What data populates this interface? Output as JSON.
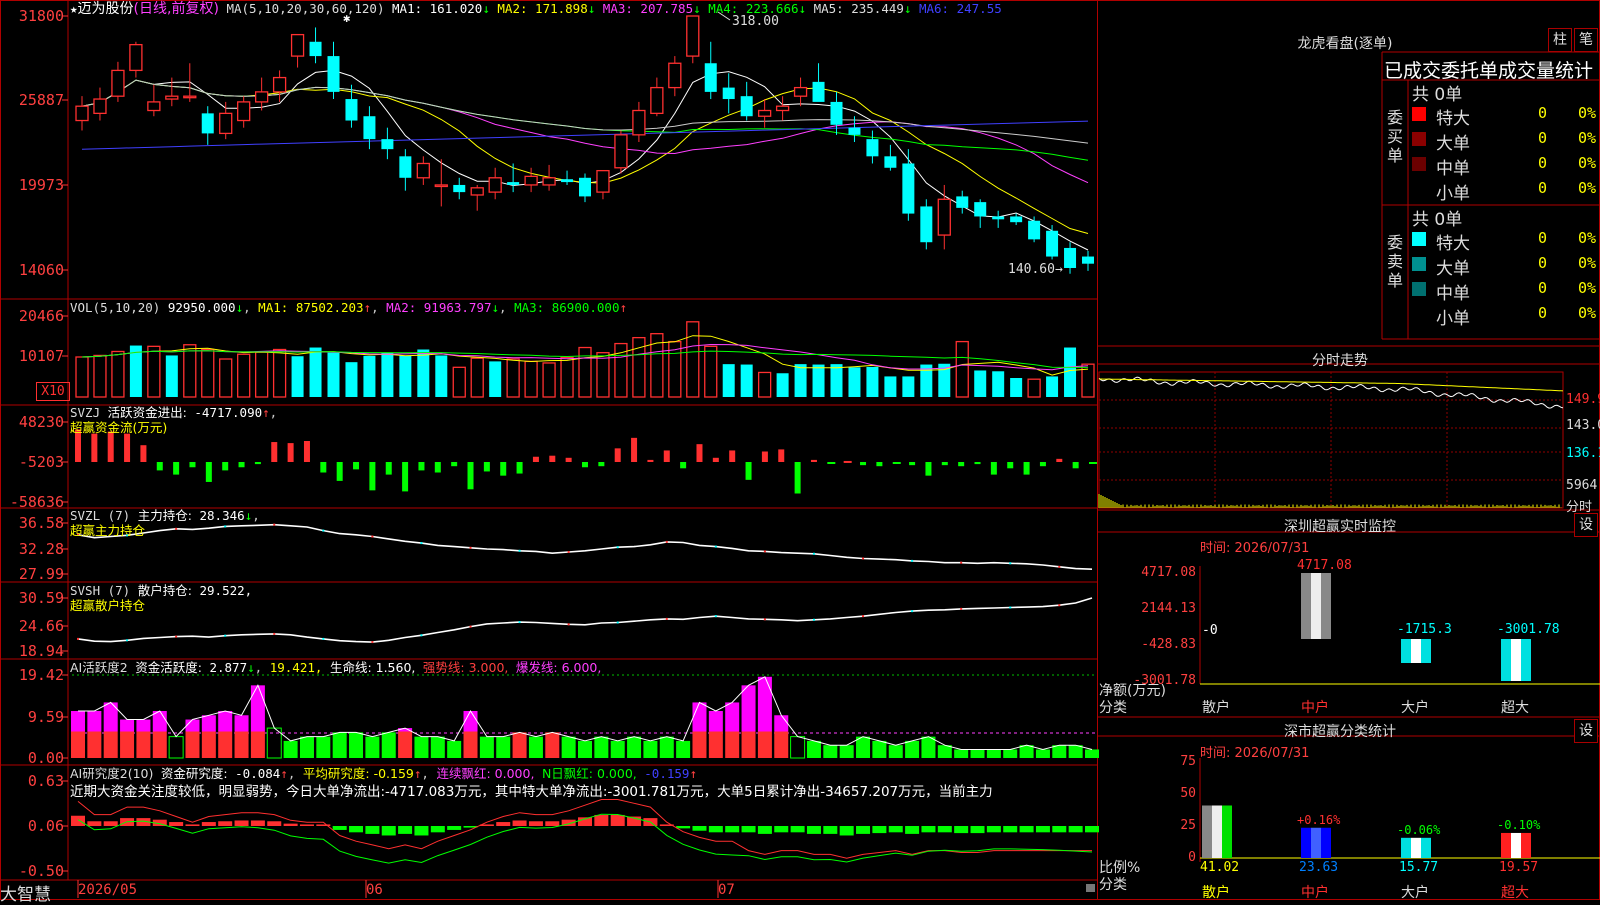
{
  "stock": {
    "name": "迈为股份",
    "period_label": "(日线,前复权)",
    "star": "★"
  },
  "ma_header": {
    "prefix": "MA(5,10,20,30,60,120)",
    "items": [
      {
        "label": "MA1:",
        "value": "161.020",
        "arrow": "↓",
        "color": "#ffffff"
      },
      {
        "label": "MA2:",
        "value": "171.898",
        "arrow": "↓",
        "color": "#ffff00"
      },
      {
        "label": "MA3:",
        "value": "207.785",
        "arrow": "↓",
        "color": "#ff40ff"
      },
      {
        "label": "MA4:",
        "value": "223.666",
        "arrow": "↓",
        "color": "#00ff00"
      },
      {
        "label": "MA5:",
        "value": "235.449",
        "arrow": "↓",
        "color": "#dddddd"
      },
      {
        "label": "MA6:",
        "value": "247.55",
        "arrow": "",
        "color": "#4040ff"
      }
    ]
  },
  "price_axis": [
    "31800",
    "25887",
    "19973",
    "14060"
  ],
  "price_annotations": {
    "high": "318.00",
    "low": "140.60"
  },
  "vol_header": {
    "prefix": "VOL(5,10,20)",
    "value": "92950.000",
    "ma1": "87502.203",
    "ma2": "91963.797",
    "ma3": "86900.000"
  },
  "vol_axis": [
    "20466",
    "10107"
  ],
  "vol_unit": "X10",
  "svzj_header": {
    "prefix": "SVZJ",
    "label": "活跃资金进出:",
    "value": "-4717.090",
    "sub": "超赢资金流(万元)"
  },
  "svzj_axis": [
    "48230",
    "-5203",
    "-58636"
  ],
  "svzl_header": {
    "prefix": "SVZL (7)",
    "label": "主力持仓:",
    "value": "28.346",
    "sub": "超赢主力持仓"
  },
  "svzl_axis": [
    "36.58",
    "32.28",
    "27.99"
  ],
  "svsh_header": {
    "prefix": "SVSH (7)",
    "label": "散户持仓:",
    "value": "29.522,",
    "sub": "超赢散户持仓"
  },
  "svsh_axis": [
    "30.59",
    "24.66",
    "18.94"
  ],
  "ai1_header": {
    "prefix": "AI活跃度2",
    "label": "资金活跃度:",
    "value": "2.877",
    "v2": "19.421,",
    "life": "生命线: 1.560,",
    "strong": "强势线: 3.000,",
    "burst": "爆发线: 6.000,"
  },
  "ai1_axis": [
    "19.42",
    "9.59",
    "0.00"
  ],
  "ai2_header": {
    "prefix": "AI研究度2(10)",
    "label": "资金研究度:",
    "value": "-0.084",
    "avg": "平均研究度: -0.159",
    "red": "连续飘红: 0.000,",
    "nred": "N日飘红: 0.000,",
    "last": "-0.159"
  },
  "ai2_comment": "近期大资金关注度较低，明显弱势，今日大单净流出:-4717.083万元，其中特大单净流出:-3001.781万元，大单5日累计净出-34657.207万元，当前主力",
  "ai2_axis": [
    "0.63",
    "0.06",
    "-0.50"
  ],
  "date_axis": [
    "2026/05",
    "06",
    "07"
  ],
  "brand": "大智慧",
  "right_panel": {
    "top_title": "龙虎看盘(逐单)",
    "btn_col": "柱",
    "btn_pen": "笔",
    "table_title": "已成交委托单成交量统计",
    "buy_group": {
      "label": "委买单",
      "count": "共 0单",
      "rows": [
        {
          "name": "特大",
          "v": "0",
          "p": "0%",
          "color": "#ff0000"
        },
        {
          "name": "大单",
          "v": "0",
          "p": "0%",
          "color": "#8b0000"
        },
        {
          "name": "中单",
          "v": "0",
          "p": "0%",
          "color": "#6b0000"
        },
        {
          "name": "小单",
          "v": "0",
          "p": "0%",
          "color": ""
        }
      ]
    },
    "sell_group": {
      "label": "委卖单",
      "count": "共 0单",
      "rows": [
        {
          "name": "特大",
          "v": "0",
          "p": "0%",
          "color": "#00ffff"
        },
        {
          "name": "大单",
          "v": "0",
          "p": "0%",
          "color": "#009090"
        },
        {
          "name": "中单",
          "v": "0",
          "p": "0%",
          "color": "#007070"
        },
        {
          "name": "小单",
          "v": "0",
          "p": "0%",
          "color": ""
        }
      ]
    },
    "intraday_title": "分时走势",
    "intraday_axis": [
      "149.9",
      "143.0",
      "136.1",
      "5964",
      "分时"
    ],
    "sz_monitor": {
      "title": "深圳超赢实时监控",
      "set": "设",
      "time": "时间: 2026/07/31",
      "axis": [
        "4717.08",
        "2144.13",
        "-428.83",
        "-3001.78"
      ],
      "y_title": "净额(万元)",
      "x_title": "分类",
      "zero_label": "-0",
      "bars": [
        {
          "cat": "散户",
          "value": 0,
          "label": ""
        },
        {
          "cat": "中户",
          "value": 4717.08,
          "label": "4717.08"
        },
        {
          "cat": "大户",
          "value": -1715.3,
          "label": "-1715.3"
        },
        {
          "cat": "超大",
          "value": -3001.78,
          "label": "-3001.78"
        }
      ]
    },
    "sz_stats": {
      "title": "深市超赢分类统计",
      "set": "设",
      "time": "时间: 2026/07/31",
      "axis": [
        "75",
        "50",
        "25",
        "0"
      ],
      "y_title": "比例%",
      "x_title": "分类",
      "bars": [
        {
          "cat": "散户",
          "value": 41.02,
          "label": "41.02",
          "chg": ""
        },
        {
          "cat": "中户",
          "value": 23.63,
          "label": "23.63",
          "chg": "+0.16%"
        },
        {
          "cat": "大户",
          "value": 15.77,
          "label": "15.77",
          "chg": "-0.06%"
        },
        {
          "cat": "超大",
          "value": 19.57,
          "label": "19.57",
          "chg": "-0.10%"
        }
      ]
    }
  },
  "chart_data": {
    "type": "candlestick",
    "ohlc": [
      [
        245,
        262,
        238,
        255
      ],
      [
        250,
        268,
        245,
        260
      ],
      [
        262,
        286,
        258,
        280
      ],
      [
        280,
        300,
        275,
        298
      ],
      [
        252,
        270,
        248,
        258
      ],
      [
        260,
        275,
        255,
        262
      ],
      [
        262,
        285,
        258,
        262
      ],
      [
        250,
        255,
        228,
        236
      ],
      [
        236,
        258,
        232,
        250
      ],
      [
        245,
        262,
        240,
        258
      ],
      [
        258,
        275,
        252,
        265
      ],
      [
        265,
        280,
        258,
        275
      ],
      [
        290,
        305,
        282,
        305
      ],
      [
        300,
        310,
        285,
        290
      ],
      [
        290,
        300,
        260,
        265
      ],
      [
        260,
        270,
        240,
        245
      ],
      [
        248,
        255,
        225,
        232
      ],
      [
        232,
        240,
        218,
        225
      ],
      [
        220,
        225,
        196,
        205
      ],
      [
        205,
        220,
        200,
        215
      ],
      [
        200,
        218,
        185,
        200
      ],
      [
        200,
        205,
        190,
        195
      ],
      [
        193,
        200,
        182,
        198
      ],
      [
        195,
        212,
        190,
        205
      ],
      [
        202,
        215,
        195,
        200
      ],
      [
        200,
        212,
        195,
        206
      ],
      [
        200,
        214,
        196,
        205
      ],
      [
        204,
        210,
        200,
        202
      ],
      [
        205,
        208,
        188,
        192
      ],
      [
        195,
        210,
        190,
        210
      ],
      [
        212,
        238,
        208,
        235
      ],
      [
        235,
        258,
        230,
        252
      ],
      [
        250,
        275,
        248,
        268
      ],
      [
        268,
        290,
        262,
        285
      ],
      [
        290,
        318,
        285,
        318
      ],
      [
        285,
        300,
        260,
        265
      ],
      [
        268,
        278,
        250,
        260
      ],
      [
        262,
        272,
        245,
        248
      ],
      [
        248,
        260,
        240,
        252
      ],
      [
        252,
        262,
        245,
        255
      ],
      [
        262,
        275,
        255,
        268
      ],
      [
        272,
        285,
        260,
        258
      ],
      [
        258,
        265,
        235,
        242
      ],
      [
        240,
        248,
        230,
        235
      ],
      [
        232,
        238,
        215,
        220
      ],
      [
        220,
        228,
        210,
        212
      ],
      [
        215,
        225,
        175,
        180
      ],
      [
        185,
        190,
        155,
        160
      ],
      [
        165,
        200,
        155,
        190
      ],
      [
        192,
        196,
        180,
        184
      ],
      [
        188,
        190,
        170,
        178
      ],
      [
        178,
        182,
        170,
        176
      ],
      [
        178,
        180,
        172,
        174
      ],
      [
        175,
        178,
        160,
        162
      ],
      [
        168,
        172,
        148,
        150
      ],
      [
        156,
        160,
        138,
        142
      ],
      [
        150,
        154,
        140,
        145
      ]
    ],
    "volume": [
      [
        10107,
        "r"
      ],
      [
        10500,
        "r"
      ],
      [
        11500,
        "r"
      ],
      [
        13000,
        "c"
      ],
      [
        12800,
        "r"
      ],
      [
        10500,
        "c"
      ],
      [
        13200,
        "r"
      ],
      [
        12000,
        "r"
      ],
      [
        9600,
        "r"
      ],
      [
        10800,
        "r"
      ],
      [
        11300,
        "r"
      ],
      [
        12000,
        "r"
      ],
      [
        10300,
        "c"
      ],
      [
        12500,
        "c"
      ],
      [
        11200,
        "c"
      ],
      [
        8800,
        "c"
      ],
      [
        10400,
        "c"
      ],
      [
        11200,
        "c"
      ],
      [
        10500,
        "c"
      ],
      [
        12000,
        "c"
      ],
      [
        10500,
        "c"
      ],
      [
        7500,
        "r"
      ],
      [
        9800,
        "r"
      ],
      [
        9000,
        "c"
      ],
      [
        9600,
        "r"
      ],
      [
        9000,
        "r"
      ],
      [
        8600,
        "r"
      ],
      [
        10000,
        "r"
      ],
      [
        12500,
        "r"
      ],
      [
        11200,
        "r"
      ],
      [
        13500,
        "r"
      ],
      [
        15000,
        "r"
      ],
      [
        16000,
        "r"
      ],
      [
        14000,
        "r"
      ],
      [
        19000,
        "r"
      ],
      [
        12800,
        "r"
      ],
      [
        8300,
        "c"
      ],
      [
        8200,
        "c"
      ],
      [
        6200,
        "r"
      ],
      [
        6000,
        "c"
      ],
      [
        8300,
        "c"
      ],
      [
        8200,
        "c"
      ],
      [
        8300,
        "c"
      ],
      [
        7500,
        "c"
      ],
      [
        7600,
        "c"
      ],
      [
        5200,
        "c"
      ],
      [
        5200,
        "c"
      ],
      [
        8200,
        "c"
      ],
      [
        8400,
        "c"
      ],
      [
        14000,
        "r"
      ],
      [
        6700,
        "c"
      ],
      [
        6500,
        "c"
      ],
      [
        4800,
        "c"
      ],
      [
        4500,
        "r"
      ],
      [
        5200,
        "c"
      ],
      [
        12500,
        "c"
      ],
      [
        8300,
        "r"
      ]
    ],
    "svzj": [
      31,
      27,
      29,
      27,
      16,
      -8,
      -12,
      -5,
      -19,
      -8,
      -5,
      -2,
      19,
      18,
      20,
      -10,
      -18,
      -7,
      -27,
      -12,
      -28,
      -8,
      -10,
      -4,
      -26,
      -9,
      -13,
      -11,
      5,
      6,
      4,
      -5,
      -4,
      13,
      23,
      2,
      11,
      -6,
      17,
      4,
      11,
      -17,
      10,
      12,
      -30,
      2,
      -1,
      1,
      -3,
      -4,
      -1,
      -3,
      -13,
      -3,
      -4,
      -2,
      -12,
      -6,
      -12,
      -4,
      3,
      -6,
      -1
    ],
    "svzl": [
      34.6,
      34.1,
      34.3,
      34.5,
      34.9,
      35.3,
      35.6,
      35.5,
      35.7,
      36.0,
      36.1,
      36.2,
      36.3,
      36.1,
      35.9,
      35.3,
      34.8,
      34.6,
      34.3,
      33.9,
      33.5,
      33.2,
      32.8,
      32.6,
      32.4,
      32.2,
      32.1,
      31.9,
      31.8,
      31.5,
      31.7,
      31.9,
      32.2,
      32.5,
      32.6,
      32.9,
      33.4,
      33.3,
      32.8,
      32.6,
      32.3,
      31.9,
      31.8,
      31.6,
      31.5,
      31.4,
      31.1,
      30.8,
      30.6,
      30.5,
      30.4,
      30.2,
      30.1,
      29.9,
      29.9,
      29.8,
      29.9,
      29.8,
      29.7,
      29.5,
      29.2,
      28.9,
      28.8
    ],
    "svsh": [
      21.6,
      21.1,
      21.0,
      21.3,
      21.7,
      21.9,
      22.1,
      22.2,
      22.0,
      22.3,
      22.5,
      22.6,
      22.7,
      22.5,
      22.0,
      21.6,
      21.2,
      21.0,
      20.9,
      21.3,
      21.9,
      22.4,
      23.0,
      23.6,
      24.3,
      24.9,
      25.1,
      25.3,
      25.2,
      25.0,
      24.8,
      24.7,
      25.1,
      25.2,
      25.5,
      25.8,
      26.0,
      25.9,
      26.3,
      26.6,
      26.3,
      26.0,
      25.9,
      25.8,
      25.6,
      25.8,
      26.0,
      26.3,
      26.6,
      27.0,
      27.4,
      27.7,
      27.9,
      28.0,
      28.2,
      28.3,
      28.4,
      28.5,
      28.6,
      28.7,
      29.0,
      29.5,
      30.6
    ],
    "ai1": [
      [
        11,
        "m"
      ],
      [
        11,
        "m"
      ],
      [
        13,
        "m"
      ],
      [
        9,
        "m"
      ],
      [
        9,
        "m"
      ],
      [
        11,
        "m"
      ],
      [
        5,
        "o"
      ],
      [
        9,
        "m"
      ],
      [
        10,
        "m"
      ],
      [
        11,
        "m"
      ],
      [
        10,
        "m"
      ],
      [
        17,
        "m"
      ],
      [
        7,
        "o"
      ],
      [
        4,
        "g"
      ],
      [
        5,
        "g"
      ],
      [
        5,
        "g"
      ],
      [
        6,
        "g"
      ],
      [
        6,
        "g"
      ],
      [
        5,
        "g"
      ],
      [
        6,
        "g"
      ],
      [
        7,
        "m"
      ],
      [
        5,
        "g"
      ],
      [
        5,
        "g"
      ],
      [
        4,
        "g"
      ],
      [
        11,
        "m"
      ],
      [
        5,
        "g"
      ],
      [
        5,
        "g"
      ],
      [
        6,
        "m"
      ],
      [
        5,
        "g"
      ],
      [
        6,
        "m"
      ],
      [
        5,
        "g"
      ],
      [
        4,
        "g"
      ],
      [
        5,
        "g"
      ],
      [
        4,
        "g"
      ],
      [
        5,
        "g"
      ],
      [
        4,
        "g"
      ],
      [
        5,
        "g"
      ],
      [
        4,
        "g"
      ],
      [
        13,
        "m"
      ],
      [
        11,
        "m"
      ],
      [
        13,
        "m"
      ],
      [
        17,
        "m"
      ],
      [
        19,
        "m"
      ],
      [
        10,
        "m"
      ],
      [
        5,
        "o"
      ],
      [
        4,
        "g"
      ],
      [
        3,
        "g"
      ],
      [
        3,
        "g"
      ],
      [
        5,
        "g"
      ],
      [
        4,
        "g"
      ],
      [
        3,
        "g"
      ],
      [
        4,
        "g"
      ],
      [
        5,
        "g"
      ],
      [
        3,
        "g"
      ],
      [
        2,
        "g"
      ],
      [
        2,
        "g"
      ],
      [
        2,
        "g"
      ],
      [
        2,
        "g"
      ],
      [
        3,
        "g"
      ],
      [
        2,
        "g"
      ],
      [
        3,
        "g"
      ],
      [
        3,
        "g"
      ],
      [
        2,
        "g"
      ]
    ],
    "ai2": [
      0.13,
      0.06,
      0.06,
      0.1,
      0.1,
      0.08,
      0.05,
      0.02,
      0.05,
      0.06,
      0.07,
      0.07,
      0.06,
      0.03,
      0.02,
      0.02,
      -0.05,
      -0.08,
      -0.1,
      -0.12,
      -0.1,
      -0.12,
      -0.08,
      -0.05,
      -0.02,
      0.02,
      0.05,
      0.07,
      0.06,
      0.06,
      0.08,
      0.11,
      0.14,
      0.14,
      0.12,
      0.1,
      0.02,
      -0.03,
      -0.06,
      -0.08,
      -0.08,
      -0.08,
      -0.1,
      -0.08,
      -0.08,
      -0.1,
      -0.1,
      -0.12,
      -0.1,
      -0.09,
      -0.08,
      -0.1,
      -0.08,
      -0.08,
      -0.09,
      -0.09,
      -0.08,
      -0.08,
      -0.08,
      -0.08,
      -0.08,
      -0.08,
      -0.08
    ]
  }
}
